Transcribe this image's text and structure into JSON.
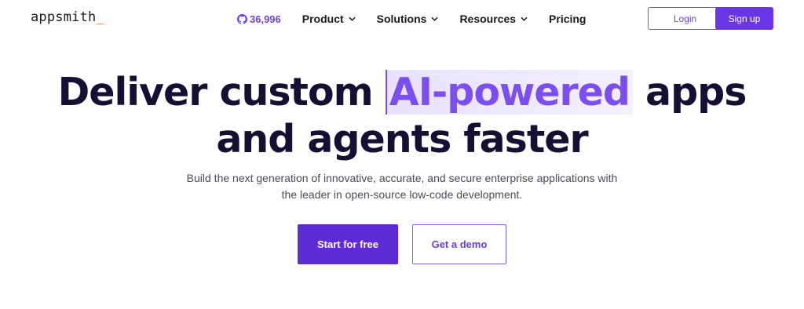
{
  "header": {
    "logo_text": "appsmith",
    "logo_cursor": "_",
    "github_stars": "36,996",
    "nav": [
      {
        "label": "Product"
      },
      {
        "label": "Solutions"
      },
      {
        "label": "Resources"
      },
      {
        "label": "Pricing"
      }
    ],
    "login_label": "Login",
    "signup_label": "Sign up"
  },
  "hero": {
    "headline_part1": "Deliver custom",
    "headline_highlight": "AI-powered",
    "headline_part2": "apps",
    "headline_line2": "and agents faster",
    "sub_line1": "Build the next generation of innovative, accurate, and secure enterprise applications with",
    "sub_line2": "the leader in open-source low-code development.",
    "primary_cta": "Start for free",
    "secondary_cta": "Get a demo"
  },
  "colors": {
    "brand_purple": "#6a35e4",
    "accent_orange": "#e8611a",
    "headline_dark": "#170f33"
  },
  "icons": [
    "github-icon",
    "chevron-down-icon"
  ]
}
